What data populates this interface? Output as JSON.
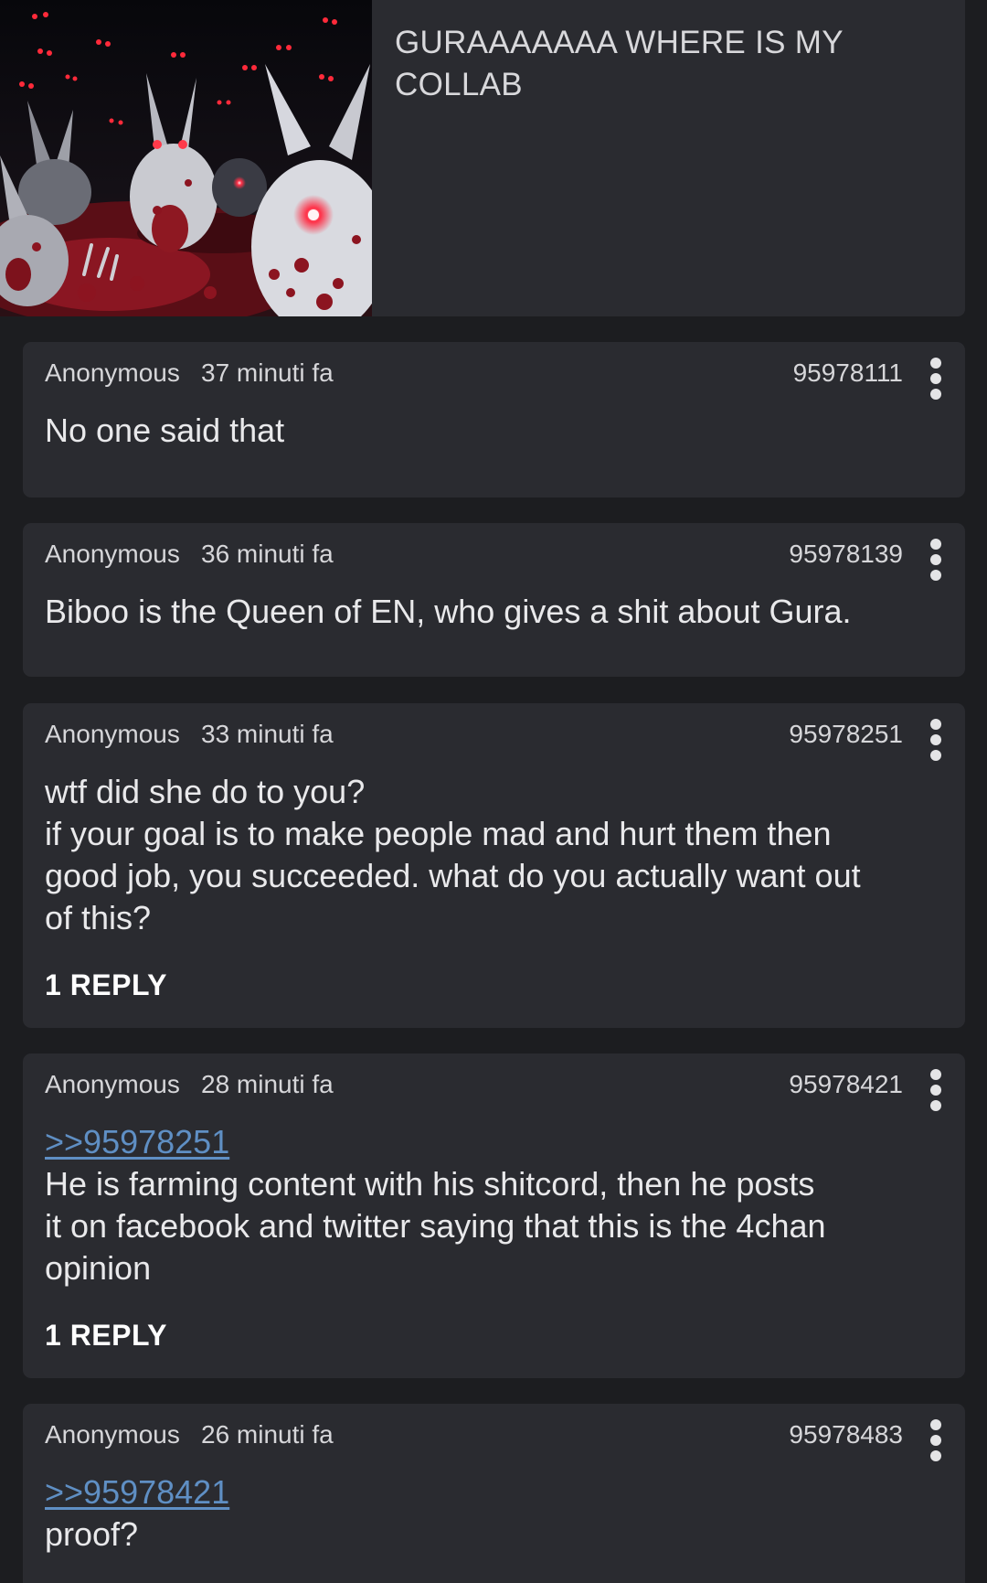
{
  "op": {
    "image_alt": "thumbnail",
    "text": "GURAAAAAAA WHERE IS MY COLLAB"
  },
  "posts": [
    {
      "author": "Anonymous",
      "time": "37 minuti fa",
      "number": "95978111",
      "quote": "",
      "lines": [
        "No one said that"
      ],
      "replies": ""
    },
    {
      "author": "Anonymous",
      "time": "36 minuti fa",
      "number": "95978139",
      "quote": "",
      "lines": [
        "Biboo is the Queen of EN, who gives a shit about Gura."
      ],
      "replies": ""
    },
    {
      "author": "Anonymous",
      "time": "33 minuti fa",
      "number": "95978251",
      "quote": "",
      "lines": [
        "wtf did she do to you?",
        "if your goal is to make people mad and hurt them then",
        "good job, you succeeded. what do you actually want out",
        "of this?"
      ],
      "replies": "1 REPLY"
    },
    {
      "author": "Anonymous",
      "time": "28 minuti fa",
      "number": "95978421",
      "quote": ">>95978251",
      "lines": [
        "He is farming content with his shitcord, then he posts",
        "it on facebook and twitter saying that this is the 4chan",
        "opinion"
      ],
      "replies": "1 REPLY"
    },
    {
      "author": "Anonymous",
      "time": "26 minuti fa",
      "number": "95978483",
      "quote": ">>95978421",
      "lines": [
        "proof?"
      ],
      "replies": ""
    }
  ],
  "colors": {
    "background": "#1c1d20",
    "card": "#2a2b30",
    "text": "#e9e9eb",
    "quote_link": "#5f8fc4"
  },
  "icons": {
    "post_menu": "more-vertical-icon"
  }
}
